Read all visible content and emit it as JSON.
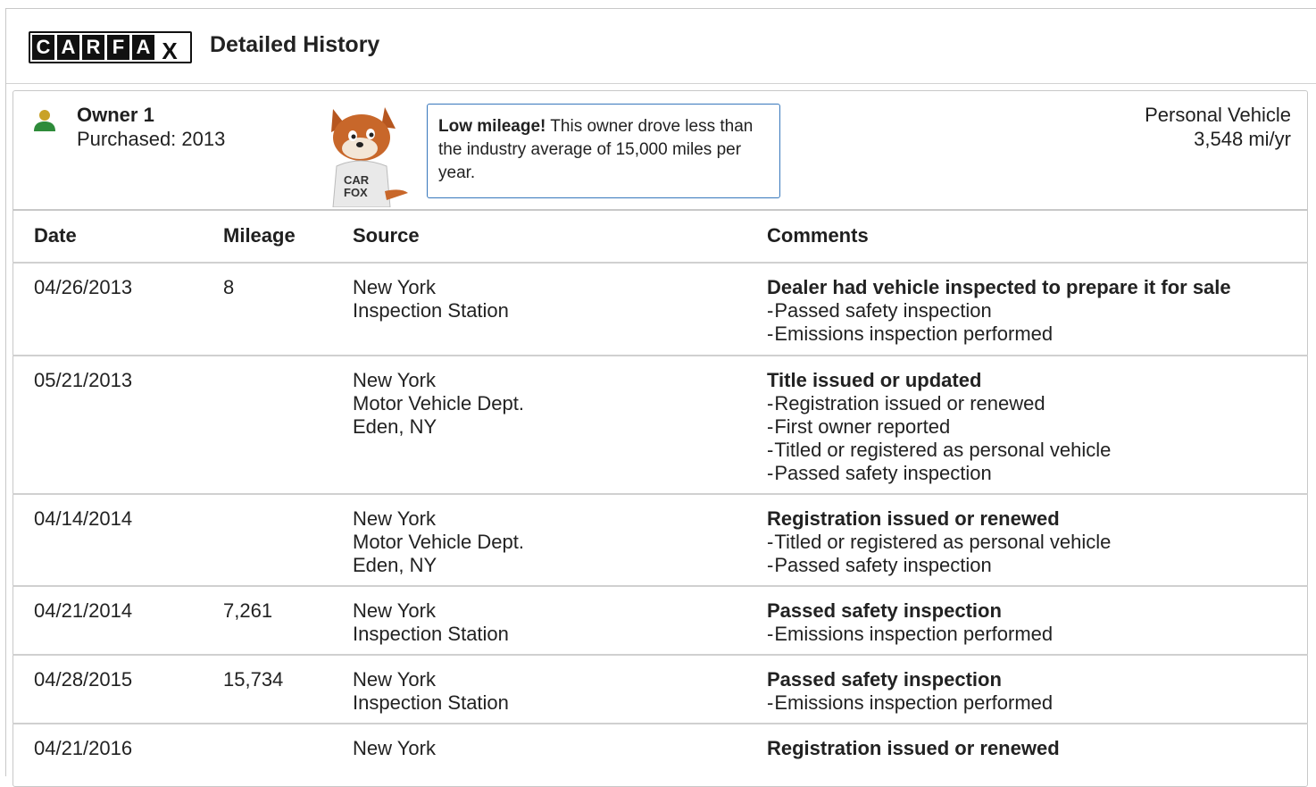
{
  "header": {
    "logo_letters": [
      "C",
      "A",
      "R",
      "F",
      "A",
      "X"
    ],
    "title": "Detailed History"
  },
  "owner": {
    "title": "Owner 1",
    "purchased": "Purchased: 2013",
    "callout_bold": "Low mileage!",
    "callout_text": " This owner drove less than the industry average of 15,000 miles per year.",
    "vehicle_type": "Personal Vehicle",
    "rate": "3,548 mi/yr",
    "fox_shirt": "CAR FOX"
  },
  "table": {
    "columns": [
      "Date",
      "Mileage",
      "Source",
      "Comments"
    ],
    "rows": [
      {
        "date": "04/26/2013",
        "mileage": "8",
        "source": [
          "New York",
          "Inspection Station"
        ],
        "title": "Dealer had vehicle inspected to prepare it for sale",
        "items": [
          "Passed safety inspection",
          "Emissions inspection performed"
        ]
      },
      {
        "date": "05/21/2013",
        "mileage": "",
        "source": [
          "New York",
          "Motor Vehicle Dept.",
          "Eden, NY"
        ],
        "title": "Title issued or updated",
        "items": [
          "Registration issued or renewed",
          "First owner reported",
          "Titled or registered as personal vehicle",
          "Passed safety inspection"
        ]
      },
      {
        "date": "04/14/2014",
        "mileage": "",
        "source": [
          "New York",
          "Motor Vehicle Dept.",
          "Eden, NY"
        ],
        "title": "Registration issued or renewed",
        "items": [
          "Titled or registered as personal vehicle",
          "Passed safety inspection"
        ]
      },
      {
        "date": "04/21/2014",
        "mileage": "7,261",
        "source": [
          "New York",
          "Inspection Station"
        ],
        "title": "Passed safety inspection",
        "items": [
          "Emissions inspection performed"
        ]
      },
      {
        "date": "04/28/2015",
        "mileage": "15,734",
        "source": [
          "New York",
          "Inspection Station"
        ],
        "title": "Passed safety inspection",
        "items": [
          "Emissions inspection performed"
        ]
      },
      {
        "date": "04/21/2016",
        "mileage": "",
        "source": [
          "New York"
        ],
        "title": "Registration issued or renewed",
        "items": []
      }
    ]
  },
  "colors": {
    "owner_icon_head": "#c9a227",
    "owner_icon_body": "#2e8b3a",
    "callout_border": "#3777bc"
  }
}
